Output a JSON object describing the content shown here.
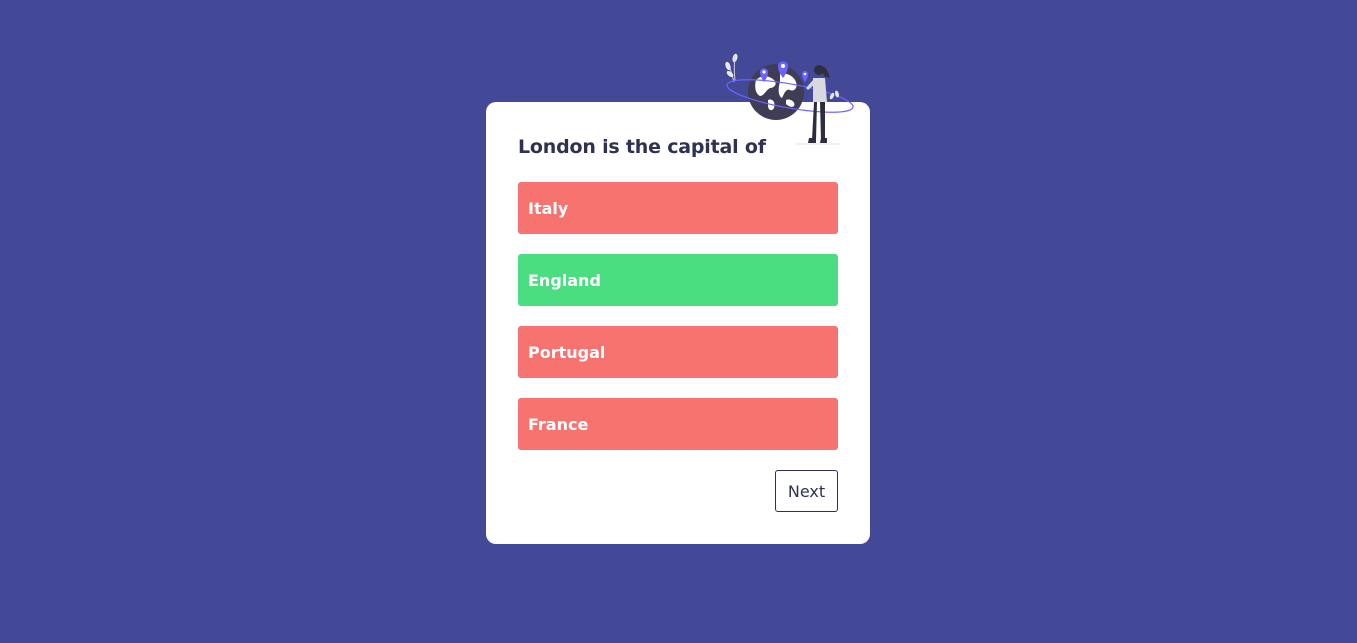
{
  "quiz": {
    "question": "London is the capital of",
    "answers": [
      {
        "label": "Italy",
        "status": "wrong"
      },
      {
        "label": "England",
        "status": "correct"
      },
      {
        "label": "Portugal",
        "status": "wrong"
      },
      {
        "label": "France",
        "status": "wrong"
      }
    ],
    "next_label": "Next"
  },
  "colors": {
    "background": "#434897",
    "card": "#ffffff",
    "wrong": "#f77370",
    "correct": "#4ade80",
    "text_dark": "#2e3150"
  },
  "illustration": {
    "icon": "world-travel-illustration"
  }
}
